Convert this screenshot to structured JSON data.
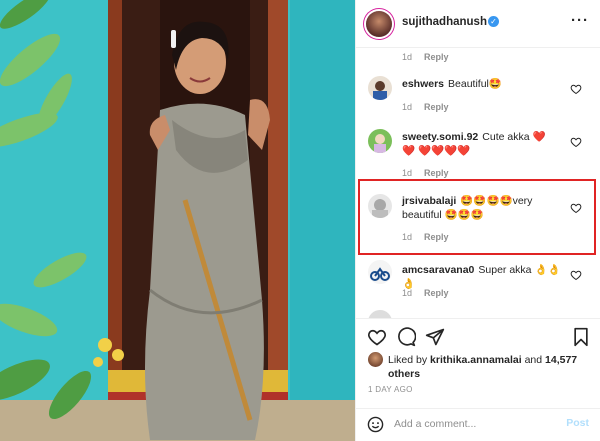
{
  "post": {
    "username": "sujithadhanush",
    "verified_icon": "verified-badge-icon",
    "more_icon": "more-options-icon"
  },
  "comments": [
    {
      "user": "",
      "text": "",
      "time": "1d",
      "reply": "Reply"
    },
    {
      "user": "eshwers",
      "text": "Beautiful🤩",
      "time": "1d",
      "reply": "Reply"
    },
    {
      "user": "sweety.somi.92",
      "text": "Cute akka ❤️❤️ ❤️❤️❤️❤️",
      "time": "1d",
      "reply": "Reply"
    },
    {
      "user": "jrsivabalaji",
      "text": "🤩🤩🤩🤩very beautiful 🤩🤩🤩",
      "time": "1d",
      "reply": "Reply"
    },
    {
      "user": "amcsaravana0",
      "text": "Super akka 👌👌👌",
      "time": "1d",
      "reply": "Reply"
    }
  ],
  "likes": {
    "prefix": "Liked by",
    "user": "krithika.annamalai",
    "joiner": "and",
    "others": "14,577 others"
  },
  "timestamp": "1 DAY AGO",
  "add_comment": {
    "placeholder": "Add a comment...",
    "post_label": "Post"
  },
  "colors": {
    "highlight": "#e02424",
    "post_button": "#b2dffc",
    "verified": "#3897f0",
    "wall": "#3fc4c8"
  }
}
